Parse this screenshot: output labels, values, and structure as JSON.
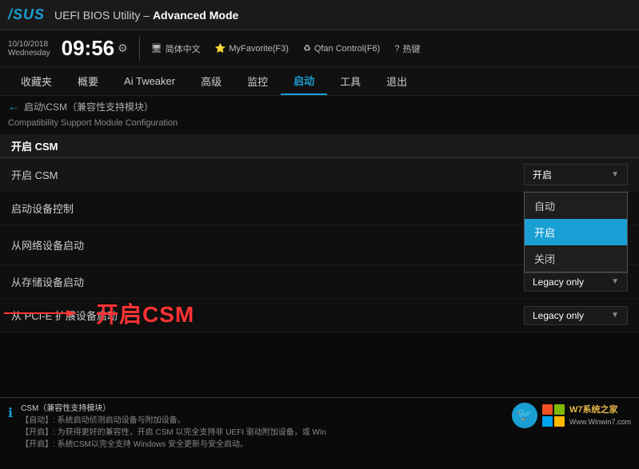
{
  "header": {
    "logo": "/SUS",
    "title_prefix": "UEFI BIOS Utility",
    "title_suffix": "Advanced Mode"
  },
  "datetime": {
    "date_line1": "10/10/2018",
    "date_line2": "Wednesday",
    "time": "09:56",
    "gear": "⚙"
  },
  "toolbar": {
    "language": "简体中文",
    "favorite": "MyFavorite(F3)",
    "qfan": "Qfan Control(F6)",
    "help": "热键"
  },
  "nav": {
    "items": [
      {
        "label": "收藏夹",
        "active": false
      },
      {
        "label": "概要",
        "active": false
      },
      {
        "label": "Ai Tweaker",
        "active": false
      },
      {
        "label": "高级",
        "active": false
      },
      {
        "label": "监控",
        "active": false
      },
      {
        "label": "启动",
        "active": true
      },
      {
        "label": "工具",
        "active": false
      },
      {
        "label": "退出",
        "active": false
      }
    ]
  },
  "breadcrumb": {
    "back_arrow": "←",
    "path": "启动\\CSM（兼容性支持模块）"
  },
  "subtitle": "Compatibility Support Module Configuration",
  "section": {
    "title": "开启 CSM"
  },
  "settings": [
    {
      "label": "开启 CSM",
      "value": "开启",
      "has_dropdown": true,
      "dropdown_open": true,
      "dropdown_items": [
        {
          "label": "自动",
          "selected": false
        },
        {
          "label": "开启",
          "selected": true
        },
        {
          "label": "关闭",
          "selected": false
        }
      ]
    },
    {
      "label": "启动设备控制",
      "value": "",
      "has_dropdown": false
    },
    {
      "label": "从网络设备启动",
      "value": "",
      "has_dropdown": false
    },
    {
      "label": "从存储设备启动",
      "value": "Legacy only",
      "has_dropdown": true,
      "dropdown_open": false
    },
    {
      "label": "从 PCI-E 扩展设备启动",
      "value": "Legacy only",
      "has_dropdown": true,
      "dropdown_open": false
    }
  ],
  "annotation": {
    "label": "开启CSM",
    "color": "#ff3333"
  },
  "info_panel": {
    "title": "CSM（兼容性支持模块）",
    "lines": [
      "【自动】: 系统启动侦测启动设备与附加设备。",
      "【开启】: 为获得更好的兼容性，开启 CSM 以完全支持非 UEFI 驱动附加设备，或 Win",
      "【开启】: 系统CSM以完全支持 Windows 安全更新与安全启动。"
    ]
  },
  "watermark": {
    "url": "Www.Winwin7.com",
    "site_name": "W7系统之家"
  }
}
